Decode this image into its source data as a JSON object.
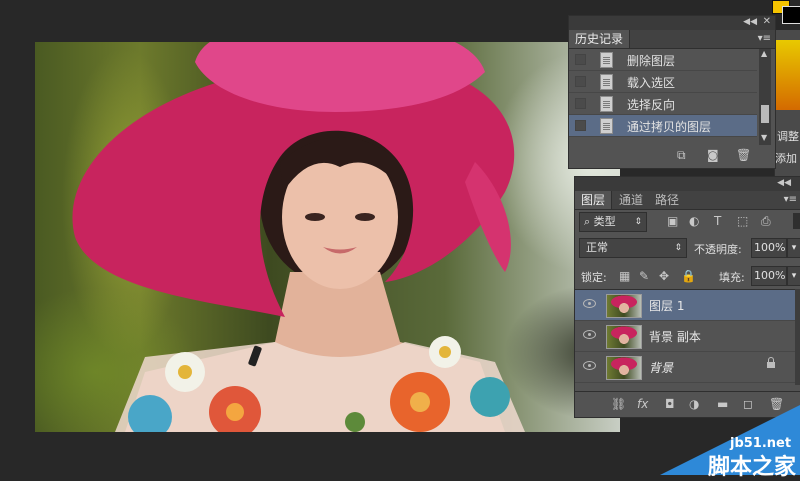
{
  "history": {
    "tab": "历史记录",
    "items": [
      {
        "label": "删除图层"
      },
      {
        "label": "载入选区"
      },
      {
        "label": "选择反向"
      },
      {
        "label": "通过拷贝的图层"
      }
    ]
  },
  "right_strip": {
    "adjust_label": "调整",
    "add_label": "添加"
  },
  "layers": {
    "tabs": [
      "图层",
      "通道",
      "路径"
    ],
    "filter": {
      "label": "类型"
    },
    "blend": {
      "value": "正常"
    },
    "opacity": {
      "label": "不透明度:",
      "value": "100%"
    },
    "lock": {
      "label": "锁定:"
    },
    "fill": {
      "label": "填充:",
      "value": "100%"
    },
    "items": [
      {
        "name": "图层 1"
      },
      {
        "name": "背景 副本"
      },
      {
        "name": "背景"
      }
    ]
  },
  "watermark": {
    "site": "jb51.net",
    "brand": "脚本之家"
  },
  "colors": {
    "panel": "#535353",
    "selected": "#5b6c87",
    "workspace": "#282828",
    "foreground_swatch": "#f5c400"
  }
}
